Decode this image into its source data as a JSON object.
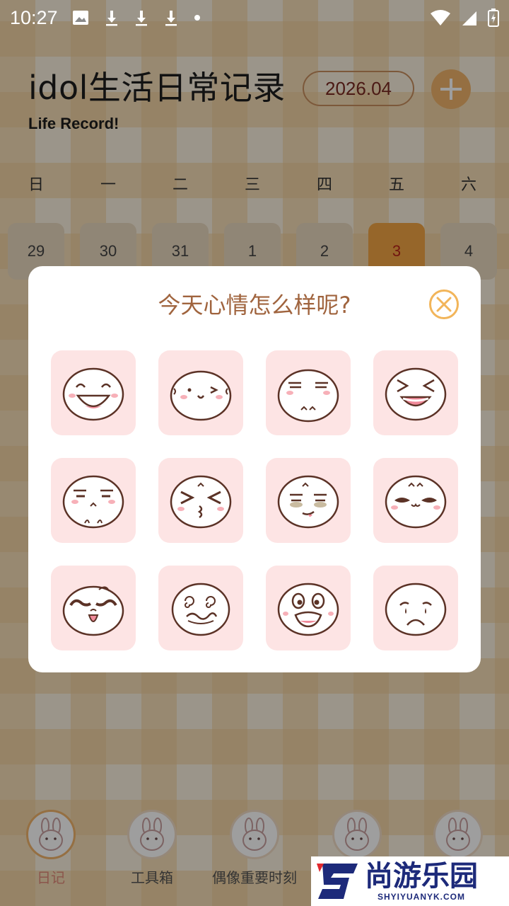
{
  "status_bar": {
    "time": "10:27",
    "left_icons": [
      "image-icon",
      "download-icon",
      "download-icon",
      "download-icon",
      "dot-icon"
    ],
    "right_icons": [
      "wifi-icon",
      "signal-icon",
      "battery-icon"
    ]
  },
  "header": {
    "title": "idol生活日常记录",
    "subtitle": "Life Record!",
    "month": "2026.04",
    "add_icon": "plus-icon"
  },
  "calendar": {
    "weekdays": [
      "日",
      "一",
      "二",
      "三",
      "四",
      "五",
      "六"
    ],
    "days": [
      "29",
      "30",
      "31",
      "1",
      "2",
      "3",
      "4"
    ],
    "today_index": 5
  },
  "bottom_nav": {
    "items": [
      {
        "label": "日记",
        "active": true
      },
      {
        "label": "工具箱",
        "active": false
      },
      {
        "label": "偶像重要时刻",
        "active": false
      },
      {
        "label": "",
        "active": false
      },
      {
        "label": "",
        "active": false
      }
    ]
  },
  "mood_dialog": {
    "title": "今天心情怎么样呢?",
    "close_icon": "close-circle-icon",
    "moods": [
      "laughing-face-icon",
      "winking-face-icon",
      "smug-face-icon",
      "squinting-grin-face-icon",
      "side-eye-face-icon",
      "kissing-face-icon",
      "tired-face-icon",
      "sunglasses-face-icon",
      "mustache-face-icon",
      "dizzy-face-icon",
      "shocked-face-icon",
      "crying-face-icon"
    ]
  },
  "watermark": {
    "text": "尚游乐园",
    "subtext": "SHYIYUANYK.COM"
  },
  "colors": {
    "accent": "#f0b46b",
    "dialog_title": "#a0643e",
    "mood_tile": "#fde4e4",
    "today": "#f2a544",
    "today_text": "#b8221a"
  }
}
